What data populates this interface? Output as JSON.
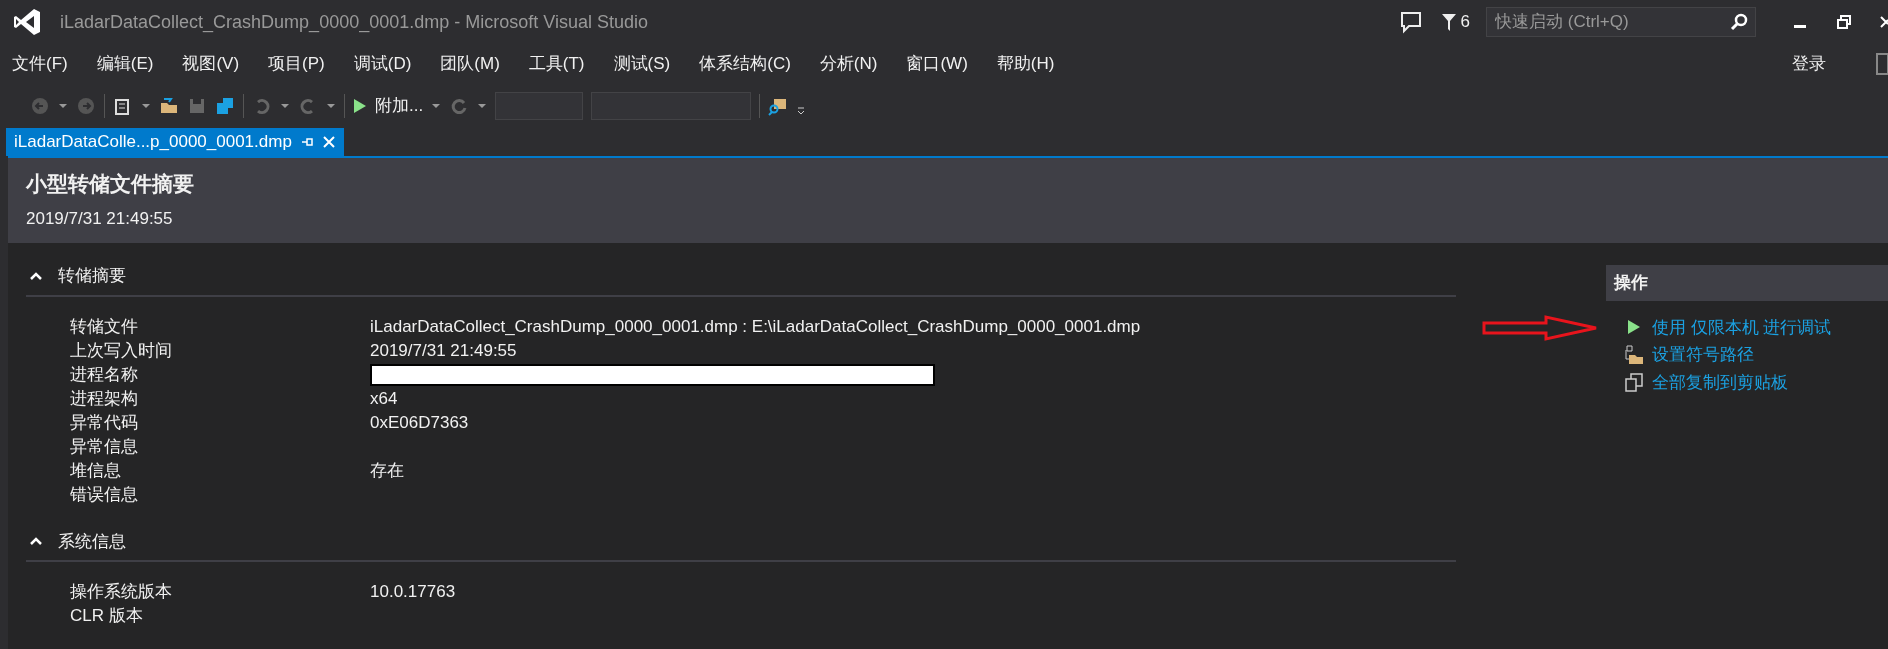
{
  "window": {
    "title": "iLadarDataCollect_CrashDump_0000_0001.dmp - Microsoft Visual Studio",
    "notification_count": "6",
    "quick_launch": {
      "placeholder": "快速启动 (Ctrl+Q)"
    }
  },
  "menu": [
    "文件(F)",
    "编辑(E)",
    "视图(V)",
    "项目(P)",
    "调试(D)",
    "团队(M)",
    "工具(T)",
    "测试(S)",
    "体系结构(C)",
    "分析(N)",
    "窗口(W)",
    "帮助(H)"
  ],
  "sign_in": "登录",
  "toolbar": {
    "attach_label": "附加..."
  },
  "tabs": [
    {
      "label": "iLadarDataColle...p_0000_0001.dmp",
      "selected": true
    }
  ],
  "header": {
    "title": "小型转储文件摘要",
    "timestamp": "2019/7/31 21:49:55"
  },
  "sections": [
    {
      "title": "转储摘要",
      "expanded": true,
      "rows": [
        {
          "label": "转储文件",
          "value": "iLadarDataCollect_CrashDump_0000_0001.dmp : E:\\iLadarDataCollect_CrashDump_0000_0001.dmp",
          "kind": "text"
        },
        {
          "label": "上次写入时间",
          "value": "2019/7/31 21:49:55",
          "kind": "text"
        },
        {
          "label": "进程名称",
          "kind": "redacted"
        },
        {
          "label": "进程架构",
          "value": "x64",
          "kind": "text"
        },
        {
          "label": "异常代码",
          "value": "0xE06D7363",
          "kind": "text"
        },
        {
          "label": "异常信息",
          "kind": "text"
        },
        {
          "label": "堆信息",
          "value": "存在",
          "kind": "text"
        },
        {
          "label": "错误信息",
          "kind": "text"
        }
      ]
    },
    {
      "title": "系统信息",
      "expanded": true,
      "rows": [
        {
          "label": "操作系统版本",
          "value": "10.0.17763",
          "kind": "text"
        },
        {
          "label": "CLR 版本",
          "kind": "text"
        }
      ]
    }
  ],
  "actions": {
    "title": "操作",
    "items": [
      {
        "kind": "debug",
        "label": "使用 仅限本机 进行调试"
      },
      {
        "kind": "symbols",
        "label": "设置符号路径"
      },
      {
        "kind": "copy",
        "label": "全部复制到剪贴板"
      }
    ]
  }
}
